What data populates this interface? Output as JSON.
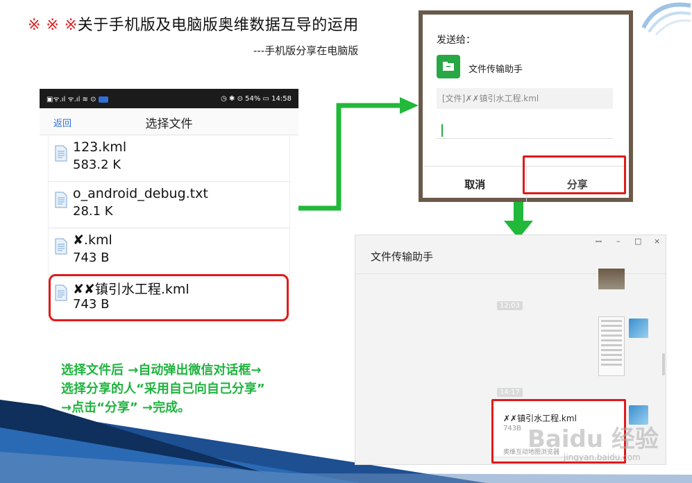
{
  "slide": {
    "title_marks": "※ ※ ※",
    "title": "关于手机版及电脑版奥维数据互导的运用",
    "subtitle": "---手机版分享在电脑版"
  },
  "phone": {
    "status_left": "▣ᯤ.ıl ᯤ.ıl ≋ ⊙",
    "status_right": "◷ ✱ ⊙ 54% ▭ 14:58",
    "back_label": "返回",
    "title": "选择文件",
    "files": [
      {
        "name": "123.kml",
        "size": "583.2 K"
      },
      {
        "name": "o_android_debug.txt",
        "size": "28.1 K"
      },
      {
        "name": "✘.kml",
        "size": "743 B"
      },
      {
        "name": "✘✘镇引水工程.kml",
        "size": "743 B"
      }
    ]
  },
  "instructions": [
    "选择文件后 →自动弹出微信对话框→",
    "选择分享的人“采用自己向自己分享”",
    "→点击“分享” →完成。"
  ],
  "dialog": {
    "heading": "发送给：",
    "contact": "文件传输助手",
    "file_label": "[文件]✗✗镇引水工程.kml",
    "cancel_label": "取消",
    "share_label": "分享"
  },
  "pc": {
    "title": "文件传输助手",
    "controls": [
      "ꟷ",
      "–",
      "□",
      "×"
    ],
    "time1": "12:03",
    "time2": "14:17",
    "file_name": "✗✗镇引水工程.kml",
    "file_size": "743B",
    "file_footer": "奥维互动地图浏览器"
  },
  "watermark": {
    "brand": "Baidu 经验",
    "url": "jingyan.baidu.com"
  },
  "colors": {
    "highlight_red": "#e01a1a",
    "arrow_green": "#22b83a",
    "note_green": "#1fb33f",
    "wechat_green": "#28a745"
  }
}
